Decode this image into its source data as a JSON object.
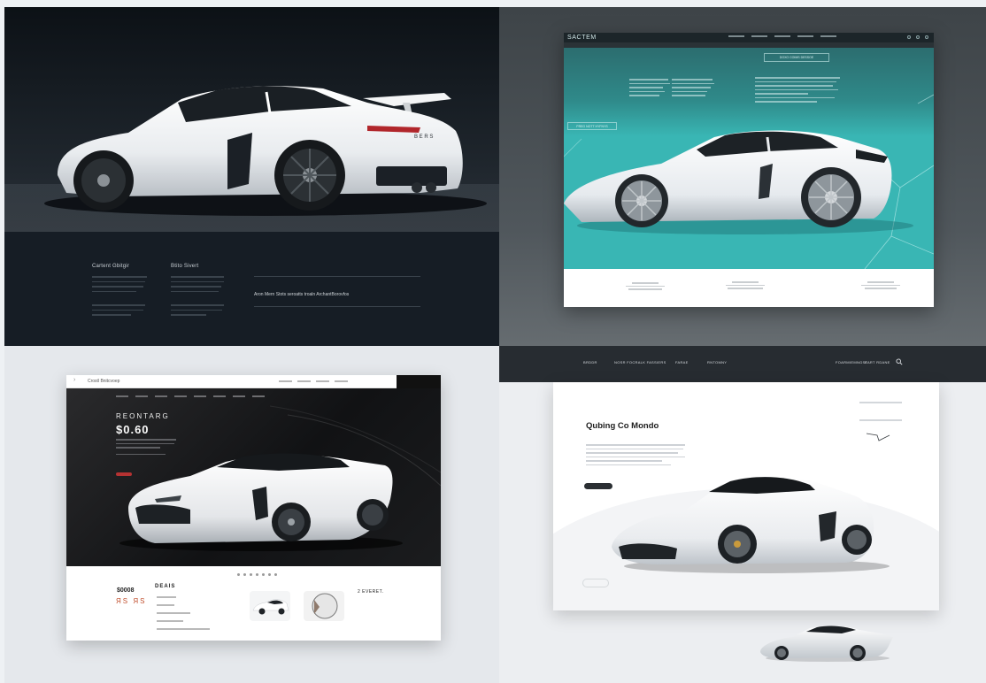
{
  "panel1": {
    "columns": [
      {
        "title": "Cartent Gbitgir"
      },
      {
        "title": "Btito Sivert"
      }
    ],
    "quote": "Aron Mern Stots seroatts troaln ArchantBorovfos"
  },
  "panel2": {
    "logo": "SACTEM",
    "cta": "DOXO COIMS DESSOE",
    "side_button": "PREG NOTT HYFNYS"
  },
  "panel3": {
    "browser_title": "Crostl Bnitcvoep",
    "subtitle": "REONTARG",
    "headline": "$0.60",
    "price": "$0008",
    "signature": "ЯS ЯS",
    "deals_title": "DEAIS",
    "ghost_title": "2 EVERET."
  },
  "panel4": {
    "nav": [
      "BRDDR",
      "NOSR FOCRALK FASSIERS",
      "FARAE",
      "RNTOMNY",
      "FOARMIEMNGST",
      "EART RDANE"
    ],
    "headline": "Qubing Co Mondo"
  },
  "colors": {
    "teal": "#39b6b4",
    "dark": "#111820",
    "accent_red": "#b53232"
  }
}
